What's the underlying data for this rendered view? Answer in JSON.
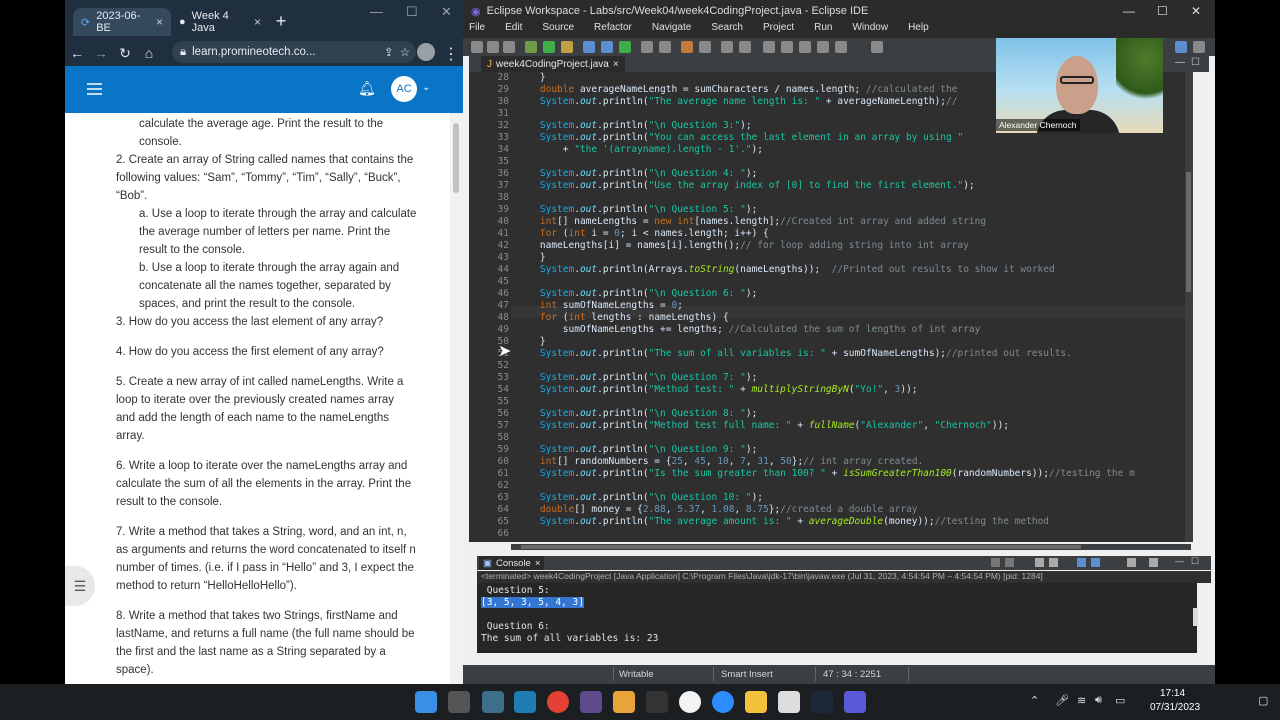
{
  "chrome": {
    "tabs": [
      {
        "label": "2023-06-BE",
        "close": "×"
      },
      {
        "label": "Week 4 Java",
        "close": "×"
      }
    ],
    "new_tab": "+",
    "url": "learn.promineotech.co...",
    "user_initials": "AC",
    "content": {
      "p0": "calculate the average age. Print the result to the console.",
      "p1": "2. Create an array of String called names that contains the following values: “Sam”, “Tommy”, “Tim”, “Sally”, “Buck”, “Bob”.",
      "p1a": "a. Use a loop to iterate through the array and calculate the average number of letters per name. Print the result to the console.",
      "p1b": "b. Use a loop to iterate through the array again and concatenate all the names together, separated by spaces, and print the result to the console.",
      "p3": "3. How do you access the last element of any array?",
      "p4": "4. How do you access the first element of any array?",
      "p5": "5. Create a new array of int called nameLengths. Write a loop to iterate over the previously created names array and add the length of each name to the nameLengths array.",
      "p6": "6. Write a loop to iterate over the nameLengths array and calculate the sum of all the elements in the array. Print the result to the console.",
      "p7": "7. Write a method that takes a String, word, and an int, n, as arguments and returns the word concatenated to itself n number of times. (i.e. if I pass in “Hello” and 3, I expect the method to return “HelloHelloHello”).",
      "p8": "8. Write a method that takes two Strings, firstName and lastName, and returns a full name (the full name should be the first and the last name as a String separated by a space)."
    }
  },
  "eclipse": {
    "title": "Eclipse Workspace - Labs/src/Week04/week4CodingProject.java - Eclipse IDE",
    "menu": [
      "File",
      "Edit",
      "Source",
      "Refactor",
      "Navigate",
      "Search",
      "Project",
      "Run",
      "Window",
      "Help"
    ],
    "editor_tab": "week4CodingProject.java",
    "line_numbers": [
      "28",
      "29",
      "30",
      "31",
      "32",
      "33",
      "34",
      "35",
      "36",
      "37",
      "38",
      "39",
      "40",
      "41",
      "42",
      "43",
      "44",
      "45",
      "46",
      "47",
      "48",
      "49",
      "50",
      "51",
      "52",
      "53",
      "54",
      "55",
      "56",
      "57",
      "58",
      "59",
      "60",
      "61",
      "62",
      "63",
      "64",
      "65",
      "66"
    ],
    "webcam_name": "Alexander Chernoch",
    "console_tab": "Console",
    "console_status": "<terminated> week4CodingProject [Java Application] C:\\Program Files\\Java\\jdk-17\\bin\\javaw.exe  (Jul 31, 2023, 4:54:54 PM – 4:54:54 PM) [pid: 1284]",
    "console_lines": [
      " Question 5:",
      "[3, 5, 3, 5, 4, 3]",
      "",
      " Question 6:",
      "The sum of all variables is: 23"
    ],
    "status": {
      "writable": "Writable",
      "insert": "Smart Insert",
      "position": "47 : 34 : 2251"
    }
  },
  "taskbar": {
    "time": "17:14",
    "date": "07/31/2023"
  }
}
